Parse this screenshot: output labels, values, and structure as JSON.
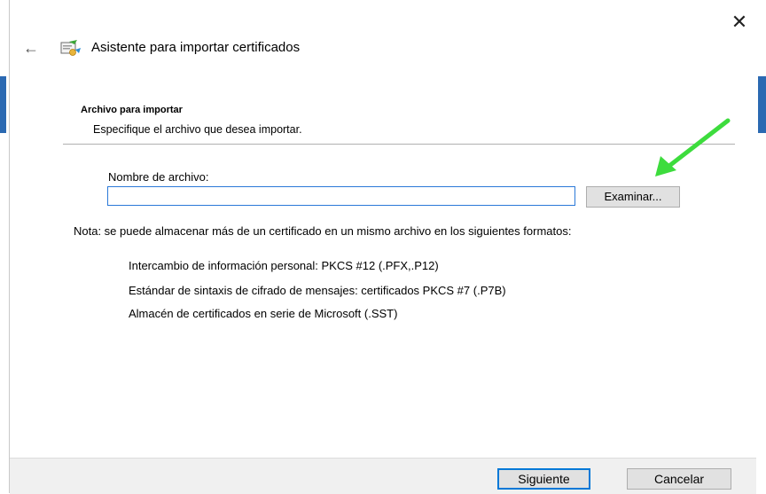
{
  "window": {
    "close_glyph": "✕",
    "back_glyph": "←",
    "title": "Asistente para importar certificados",
    "icon": "certificate-wizard-icon"
  },
  "section": {
    "title": "Archivo para importar",
    "subtitle": "Especifique el archivo que desea importar."
  },
  "file": {
    "label": "Nombre de archivo:",
    "value": "",
    "browse_label": "Examinar..."
  },
  "note": {
    "text": "Nota: se puede almacenar más de un certificado en un mismo archivo en los siguientes formatos:",
    "formats": [
      "Intercambio de información personal: PKCS #12 (.PFX,.P12)",
      "Estándar de sintaxis de cifrado de mensajes: certificados PKCS #7 (.P7B)",
      "Almacén de certificados en serie de Microsoft (.SST)"
    ]
  },
  "footer": {
    "next_label": "Siguiente",
    "cancel_label": "Cancelar"
  },
  "colors": {
    "accent": "#0078d7",
    "annotation_arrow": "#3ddc3d",
    "background_window_blue": "#2b69b2"
  }
}
